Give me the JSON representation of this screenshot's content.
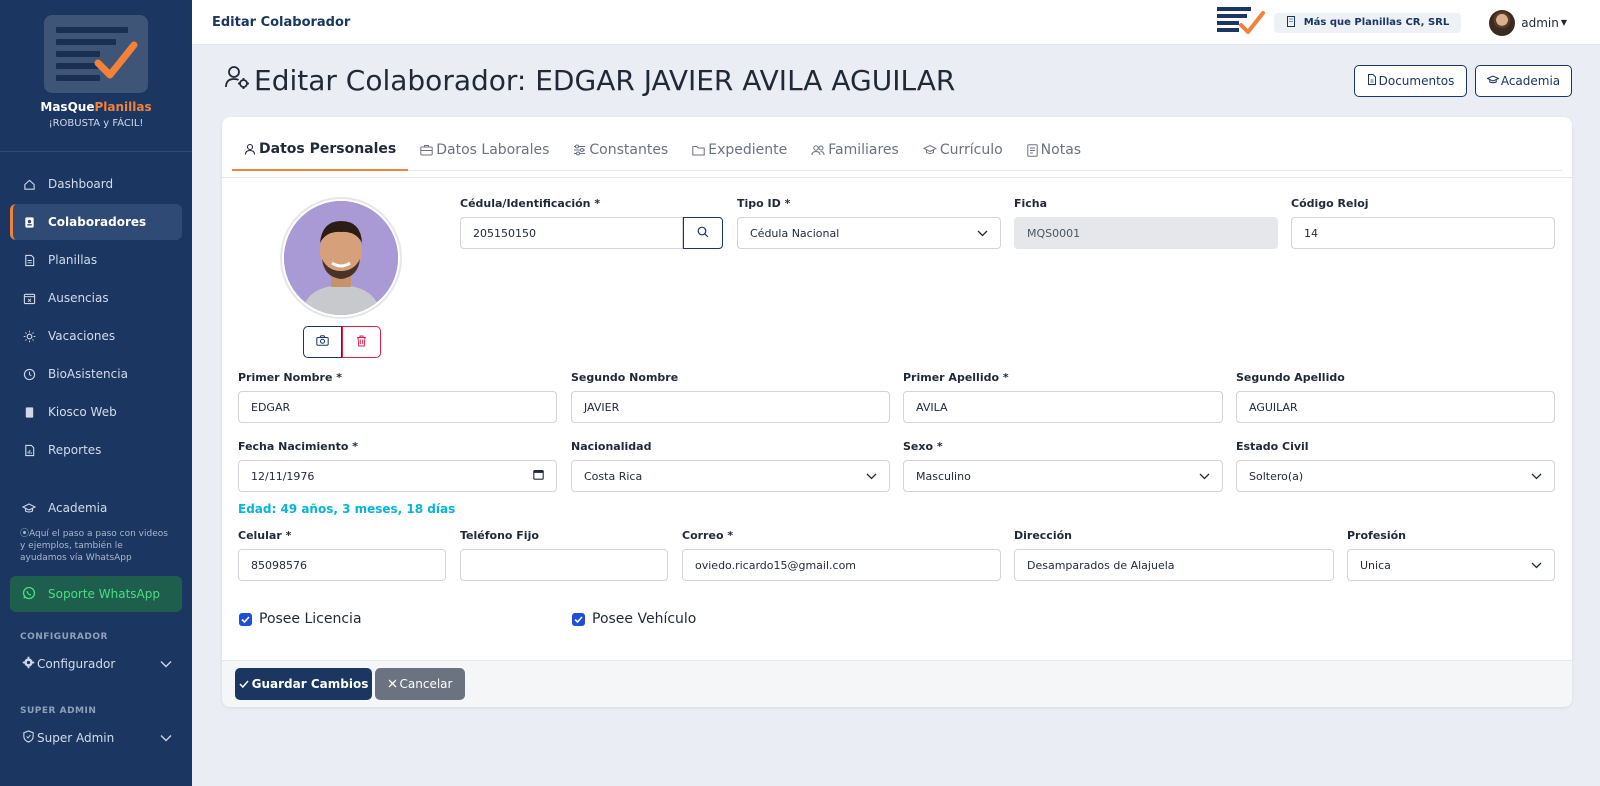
{
  "brand": {
    "name_part1": "MasQue",
    "name_part2": "Planillas",
    "tagline": "¡ROBUSTA y FÁCIL!"
  },
  "sidebar": {
    "items": [
      {
        "label": "Dashboard",
        "icon": "home-icon"
      },
      {
        "label": "Colaboradores",
        "icon": "id-badge-icon",
        "active": true
      },
      {
        "label": "Planillas",
        "icon": "document-icon"
      },
      {
        "label": "Ausencias",
        "icon": "calendar-x-icon"
      },
      {
        "label": "Vacaciones",
        "icon": "sun-icon"
      },
      {
        "label": "BioAsistencia",
        "icon": "clock-icon"
      },
      {
        "label": "Kiosco Web",
        "icon": "tablet-icon"
      },
      {
        "label": "Reportes",
        "icon": "report-icon"
      }
    ],
    "academia_label": "Academia",
    "academia_note": "Aquí el paso a paso con videos y ejemplos, también le ayudamos vía WhatsApp",
    "whatsapp_label": "Soporte WhatsApp",
    "config_section": "CONFIGURADOR",
    "config_label": "Configurador",
    "superadmin_section": "SUPER ADMIN",
    "superadmin_label": "Super Admin"
  },
  "topbar": {
    "title": "Editar Colaborador",
    "company": "Más que Planillas CR, SRL",
    "user": "admin"
  },
  "page": {
    "title": "Editar Colaborador: EDGAR JAVIER AVILA AGUILAR",
    "documentos_button": "Documentos",
    "academia_button": "Academia"
  },
  "tabs": [
    {
      "label": "Datos Personales",
      "icon": "user-icon",
      "active": true
    },
    {
      "label": "Datos Laborales",
      "icon": "briefcase-icon"
    },
    {
      "label": "Constantes",
      "icon": "sliders-icon"
    },
    {
      "label": "Expediente",
      "icon": "folder-icon"
    },
    {
      "label": "Familiares",
      "icon": "users-icon"
    },
    {
      "label": "Currículo",
      "icon": "graduation-cap-icon"
    },
    {
      "label": "Notas",
      "icon": "notes-icon"
    }
  ],
  "form": {
    "cedula": {
      "label": "Cédula/Identificación *",
      "value": "205150150"
    },
    "tipo_id": {
      "label": "Tipo ID *",
      "value": "Cédula Nacional"
    },
    "ficha": {
      "label": "Ficha",
      "value": "MQS0001"
    },
    "codigo_reloj": {
      "label": "Código Reloj",
      "value": "14"
    },
    "primer_nombre": {
      "label": "Primer Nombre *",
      "value": "EDGAR"
    },
    "segundo_nombre": {
      "label": "Segundo Nombre",
      "value": "JAVIER"
    },
    "primer_apellido": {
      "label": "Primer Apellido *",
      "value": "AVILA"
    },
    "segundo_apellido": {
      "label": "Segundo Apellido",
      "value": "AGUILAR"
    },
    "fecha_nacimiento": {
      "label": "Fecha Nacimiento *",
      "value": "12/11/1976"
    },
    "edad": "Edad: 49 años, 3 meses, 18 días",
    "nacionalidad": {
      "label": "Nacionalidad",
      "value": "Costa Rica"
    },
    "sexo": {
      "label": "Sexo *",
      "value": "Masculino"
    },
    "estado_civil": {
      "label": "Estado Civil",
      "value": "Soltero(a)"
    },
    "celular": {
      "label": "Celular *",
      "value": "85098576"
    },
    "telefono_fijo": {
      "label": "Teléfono Fijo",
      "value": ""
    },
    "correo": {
      "label": "Correo *",
      "value": "oviedo.ricardo15@gmail.com"
    },
    "direccion": {
      "label": "Dirección",
      "value": "Desamparados de Alajuela"
    },
    "profesion": {
      "label": "Profesión",
      "value": "Unica"
    },
    "posee_licencia": {
      "label": "Posee Licencia",
      "checked": true
    },
    "posee_vehiculo": {
      "label": "Posee Vehículo",
      "checked": true
    }
  },
  "actions": {
    "save": "Guardar Cambios",
    "cancel": "Cancelar"
  },
  "colors": {
    "primary": "#1b3661",
    "accent": "#f2813a",
    "info": "#06b6d4",
    "danger": "#e11d48"
  }
}
